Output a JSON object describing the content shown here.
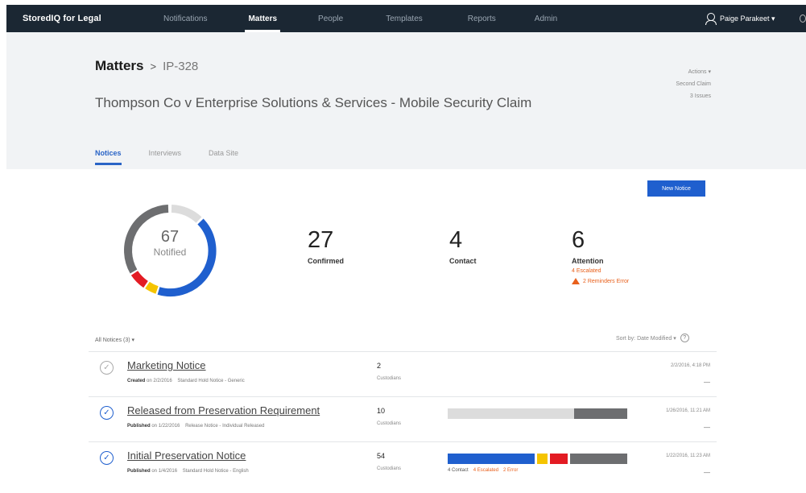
{
  "nav": {
    "brand": "StoredIQ for Legal",
    "links": [
      "Notifications",
      "Matters",
      "People",
      "Templates",
      "Reports",
      "Admin"
    ],
    "user": "Paige Parakeet ▾"
  },
  "header": {
    "crumb_root": "Matters",
    "crumb_sep": ">",
    "crumb_id": "IP-328",
    "title": "Thompson Co v Enterprise Solutions & Services - Mobile Security Claim",
    "actions": [
      "Actions ▾",
      "Second Claim",
      "3 Issues"
    ],
    "tabs": [
      "Notices",
      "Interviews",
      "Data Site"
    ]
  },
  "main": {
    "new_notice": "New Notice",
    "donut": {
      "value": "67",
      "label": "Notified"
    },
    "stats": [
      {
        "value": "27",
        "label": "Confirmed"
      },
      {
        "value": "4",
        "label": "Contact"
      },
      {
        "value": "6",
        "label": "Attention",
        "sub1": "4 Escalated",
        "sub2": "2 Reminders Error"
      }
    ],
    "filter_label": "All Notices (3) ▾",
    "sort_label": "Sort by: Date Modified ▾",
    "rows": [
      {
        "title": "Marketing Notice",
        "status": "Created",
        "date_short": "2/2/2016",
        "meta_rest": "Standard Hold Notice - Generic",
        "count": "2",
        "count_label": "Custodians",
        "date": "2/2/2016, 4:18 PM",
        "dash": "—"
      },
      {
        "title": "Released from Preservation Requirement",
        "status": "Published",
        "date_short": "1/22/2016",
        "meta_rest": "Release Notice - Individual Released",
        "count": "10",
        "count_label": "Custodians",
        "date": "1/26/2016, 11:21 AM",
        "dash": "—"
      },
      {
        "title": "Initial Preservation Notice",
        "status": "Published",
        "date_short": "1/4/2016",
        "meta_rest": "Standard Hold Notice - English",
        "count": "54",
        "count_label": "Custodians",
        "date": "1/22/2016, 11:23 AM",
        "dash": "—",
        "legend": [
          "4 Contact",
          "4 Escalated",
          "2 Error"
        ]
      }
    ]
  },
  "colors": {
    "blue": "#1f5fce",
    "yellow": "#f5c400",
    "red": "#e31b23",
    "gray": "#6d6e70",
    "light": "#dcdcdc",
    "orange": "#e8601c"
  }
}
